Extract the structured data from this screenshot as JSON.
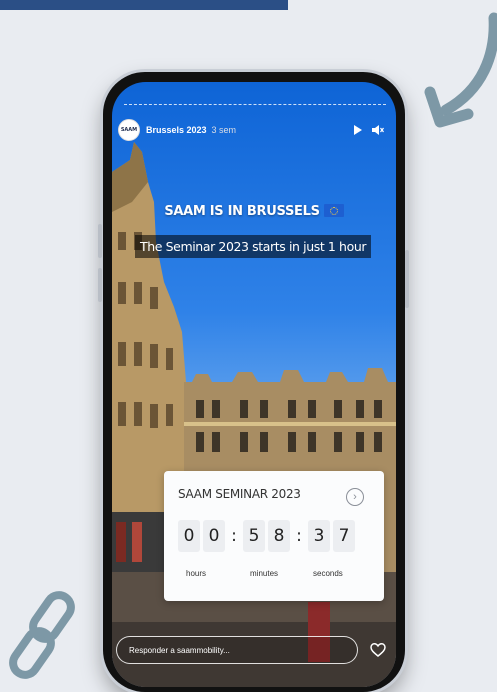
{
  "story": {
    "account": "Brussels 2023",
    "time": "3 sem",
    "avatar_text": "SAAM",
    "headline": "SAAM IS IN BRUSSELS",
    "subline": "The Seminar 2023 starts in just 1 hour"
  },
  "countdown": {
    "title": "SAAM SEMINAR 2023",
    "digits": [
      "0",
      "0",
      "5",
      "8",
      "3",
      "7"
    ],
    "labels": {
      "hours": "hours",
      "minutes": "minutes",
      "seconds": "seconds"
    }
  },
  "reply": {
    "placeholder": "Responder a saammobility..."
  },
  "icons": {
    "play": "play-icon",
    "mute": "mute-icon",
    "heart": "heart-icon",
    "chevron": "chevron-right-icon",
    "arrow": "curved-arrow-icon",
    "link": "link-icon"
  },
  "colors": {
    "banner": "#2b4f86",
    "background": "#e9ecf1",
    "arrow": "#7d98a6",
    "link": "#7d98a6"
  }
}
